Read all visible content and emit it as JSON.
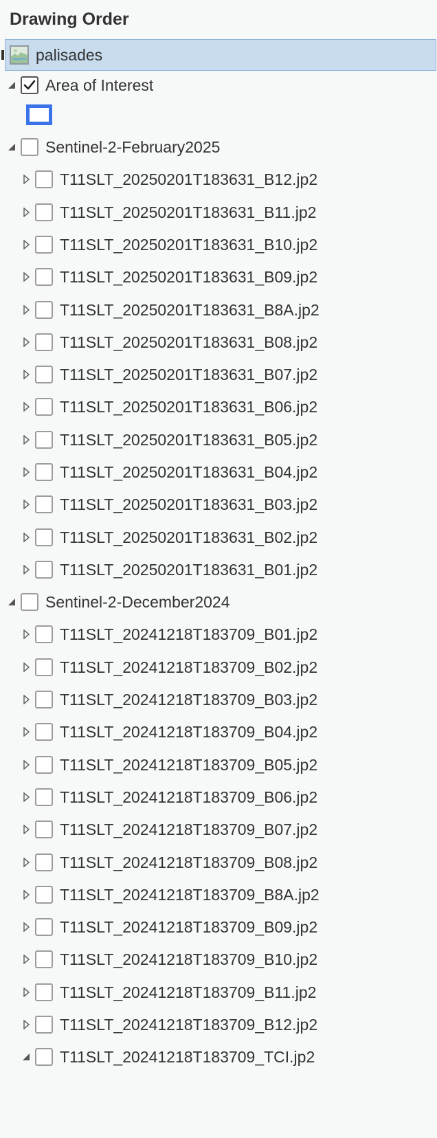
{
  "panel": {
    "title": "Drawing Order"
  },
  "map": {
    "label": "palisades",
    "icon": "map-icon"
  },
  "area_of_interest": {
    "label": "Area of Interest",
    "checked": true,
    "swatch_color": "#3b74e8"
  },
  "groups": [
    {
      "label": "Sentinel-2-February2025",
      "expanded": true,
      "checked": false,
      "layers": [
        "T11SLT_20250201T183631_B12.jp2",
        "T11SLT_20250201T183631_B11.jp2",
        "T11SLT_20250201T183631_B10.jp2",
        "T11SLT_20250201T183631_B09.jp2",
        "T11SLT_20250201T183631_B8A.jp2",
        "T11SLT_20250201T183631_B08.jp2",
        "T11SLT_20250201T183631_B07.jp2",
        "T11SLT_20250201T183631_B06.jp2",
        "T11SLT_20250201T183631_B05.jp2",
        "T11SLT_20250201T183631_B04.jp2",
        "T11SLT_20250201T183631_B03.jp2",
        "T11SLT_20250201T183631_B02.jp2",
        "T11SLT_20250201T183631_B01.jp2"
      ]
    },
    {
      "label": "Sentinel-2-December2024",
      "expanded": true,
      "checked": false,
      "layers": [
        "T11SLT_20241218T183709_B01.jp2",
        "T11SLT_20241218T183709_B02.jp2",
        "T11SLT_20241218T183709_B03.jp2",
        "T11SLT_20241218T183709_B04.jp2",
        "T11SLT_20241218T183709_B05.jp2",
        "T11SLT_20241218T183709_B06.jp2",
        "T11SLT_20241218T183709_B07.jp2",
        "T11SLT_20241218T183709_B08.jp2",
        "T11SLT_20241218T183709_B8A.jp2",
        "T11SLT_20241218T183709_B09.jp2",
        "T11SLT_20241218T183709_B10.jp2",
        "T11SLT_20241218T183709_B11.jp2",
        "T11SLT_20241218T183709_B12.jp2",
        "T11SLT_20241218T183709_TCI.jp2"
      ],
      "expanded_layer": "T11SLT_20241218T183709_TCI.jp2"
    }
  ],
  "colors": {
    "selection_background": "#c8dcee",
    "selection_border": "#8db3d8",
    "panel_background": "#f7f8f8"
  }
}
